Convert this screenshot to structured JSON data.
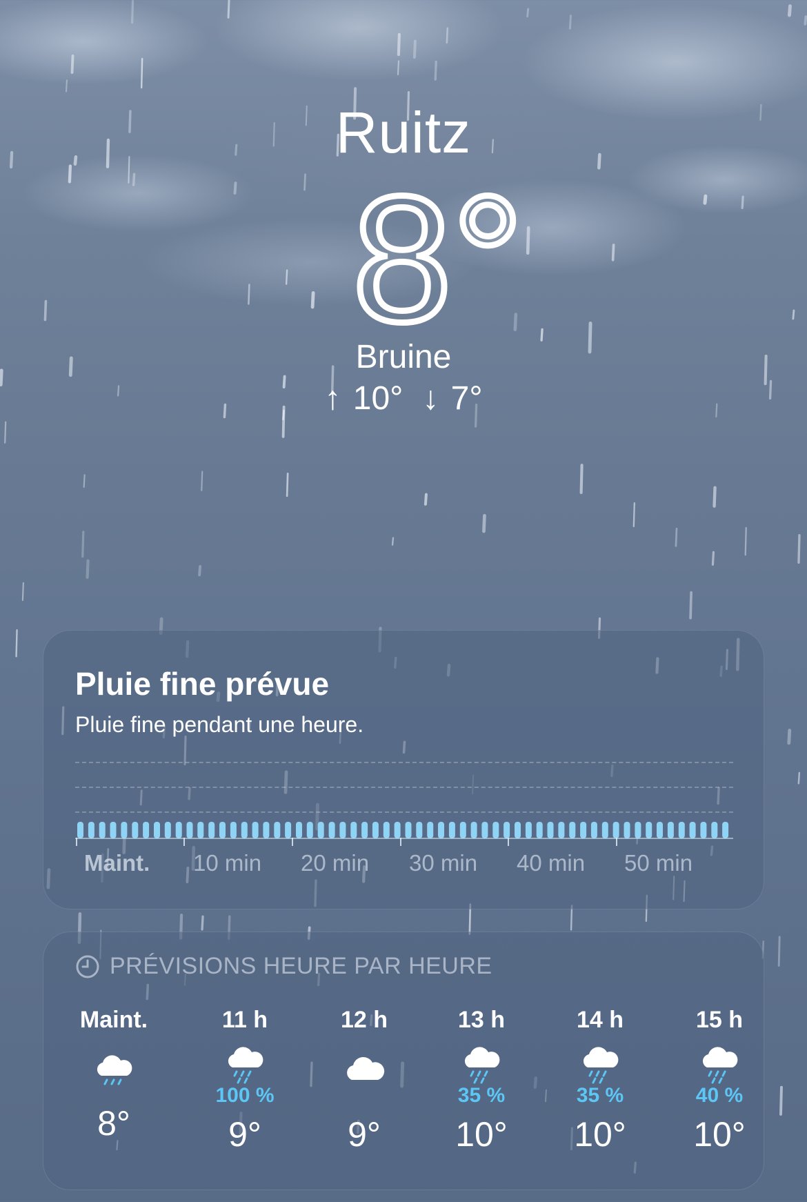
{
  "location": {
    "city": "Ruitz"
  },
  "current": {
    "temperature": "8°",
    "condition": "Bruine",
    "high": "↑ 10°",
    "low": "↓ 7°"
  },
  "precipitation_card": {
    "title": "Pluie fine prévue",
    "subtitle": "Pluie fine pendant une heure.",
    "time_labels": [
      "Maint.",
      "10 min",
      "20 min",
      "30 min",
      "40 min",
      "50 min"
    ],
    "intensity_level": "light",
    "bar_color": "#8fd4f5"
  },
  "hourly_card": {
    "header_icon": "clock-icon",
    "title": "PRÉVISIONS HEURE PAR HEURE",
    "hours": [
      {
        "time": "Maint.",
        "icon": "cloud-drizzle-icon",
        "precip": "",
        "temp": "8°"
      },
      {
        "time": "11 h",
        "icon": "cloud-rain-icon",
        "precip": "100 %",
        "temp": "9°"
      },
      {
        "time": "12 h",
        "icon": "cloud-icon",
        "precip": "",
        "temp": "9°"
      },
      {
        "time": "13 h",
        "icon": "cloud-rain-icon",
        "precip": "35 %",
        "temp": "10°"
      },
      {
        "time": "14 h",
        "icon": "cloud-rain-icon",
        "precip": "35 %",
        "temp": "10°"
      },
      {
        "time": "15 h",
        "icon": "cloud-rain-icon",
        "precip": "40 %",
        "temp": "10°"
      }
    ]
  },
  "colors": {
    "precip_accent": "#5cc6f5",
    "card_bg": "#50648280"
  }
}
